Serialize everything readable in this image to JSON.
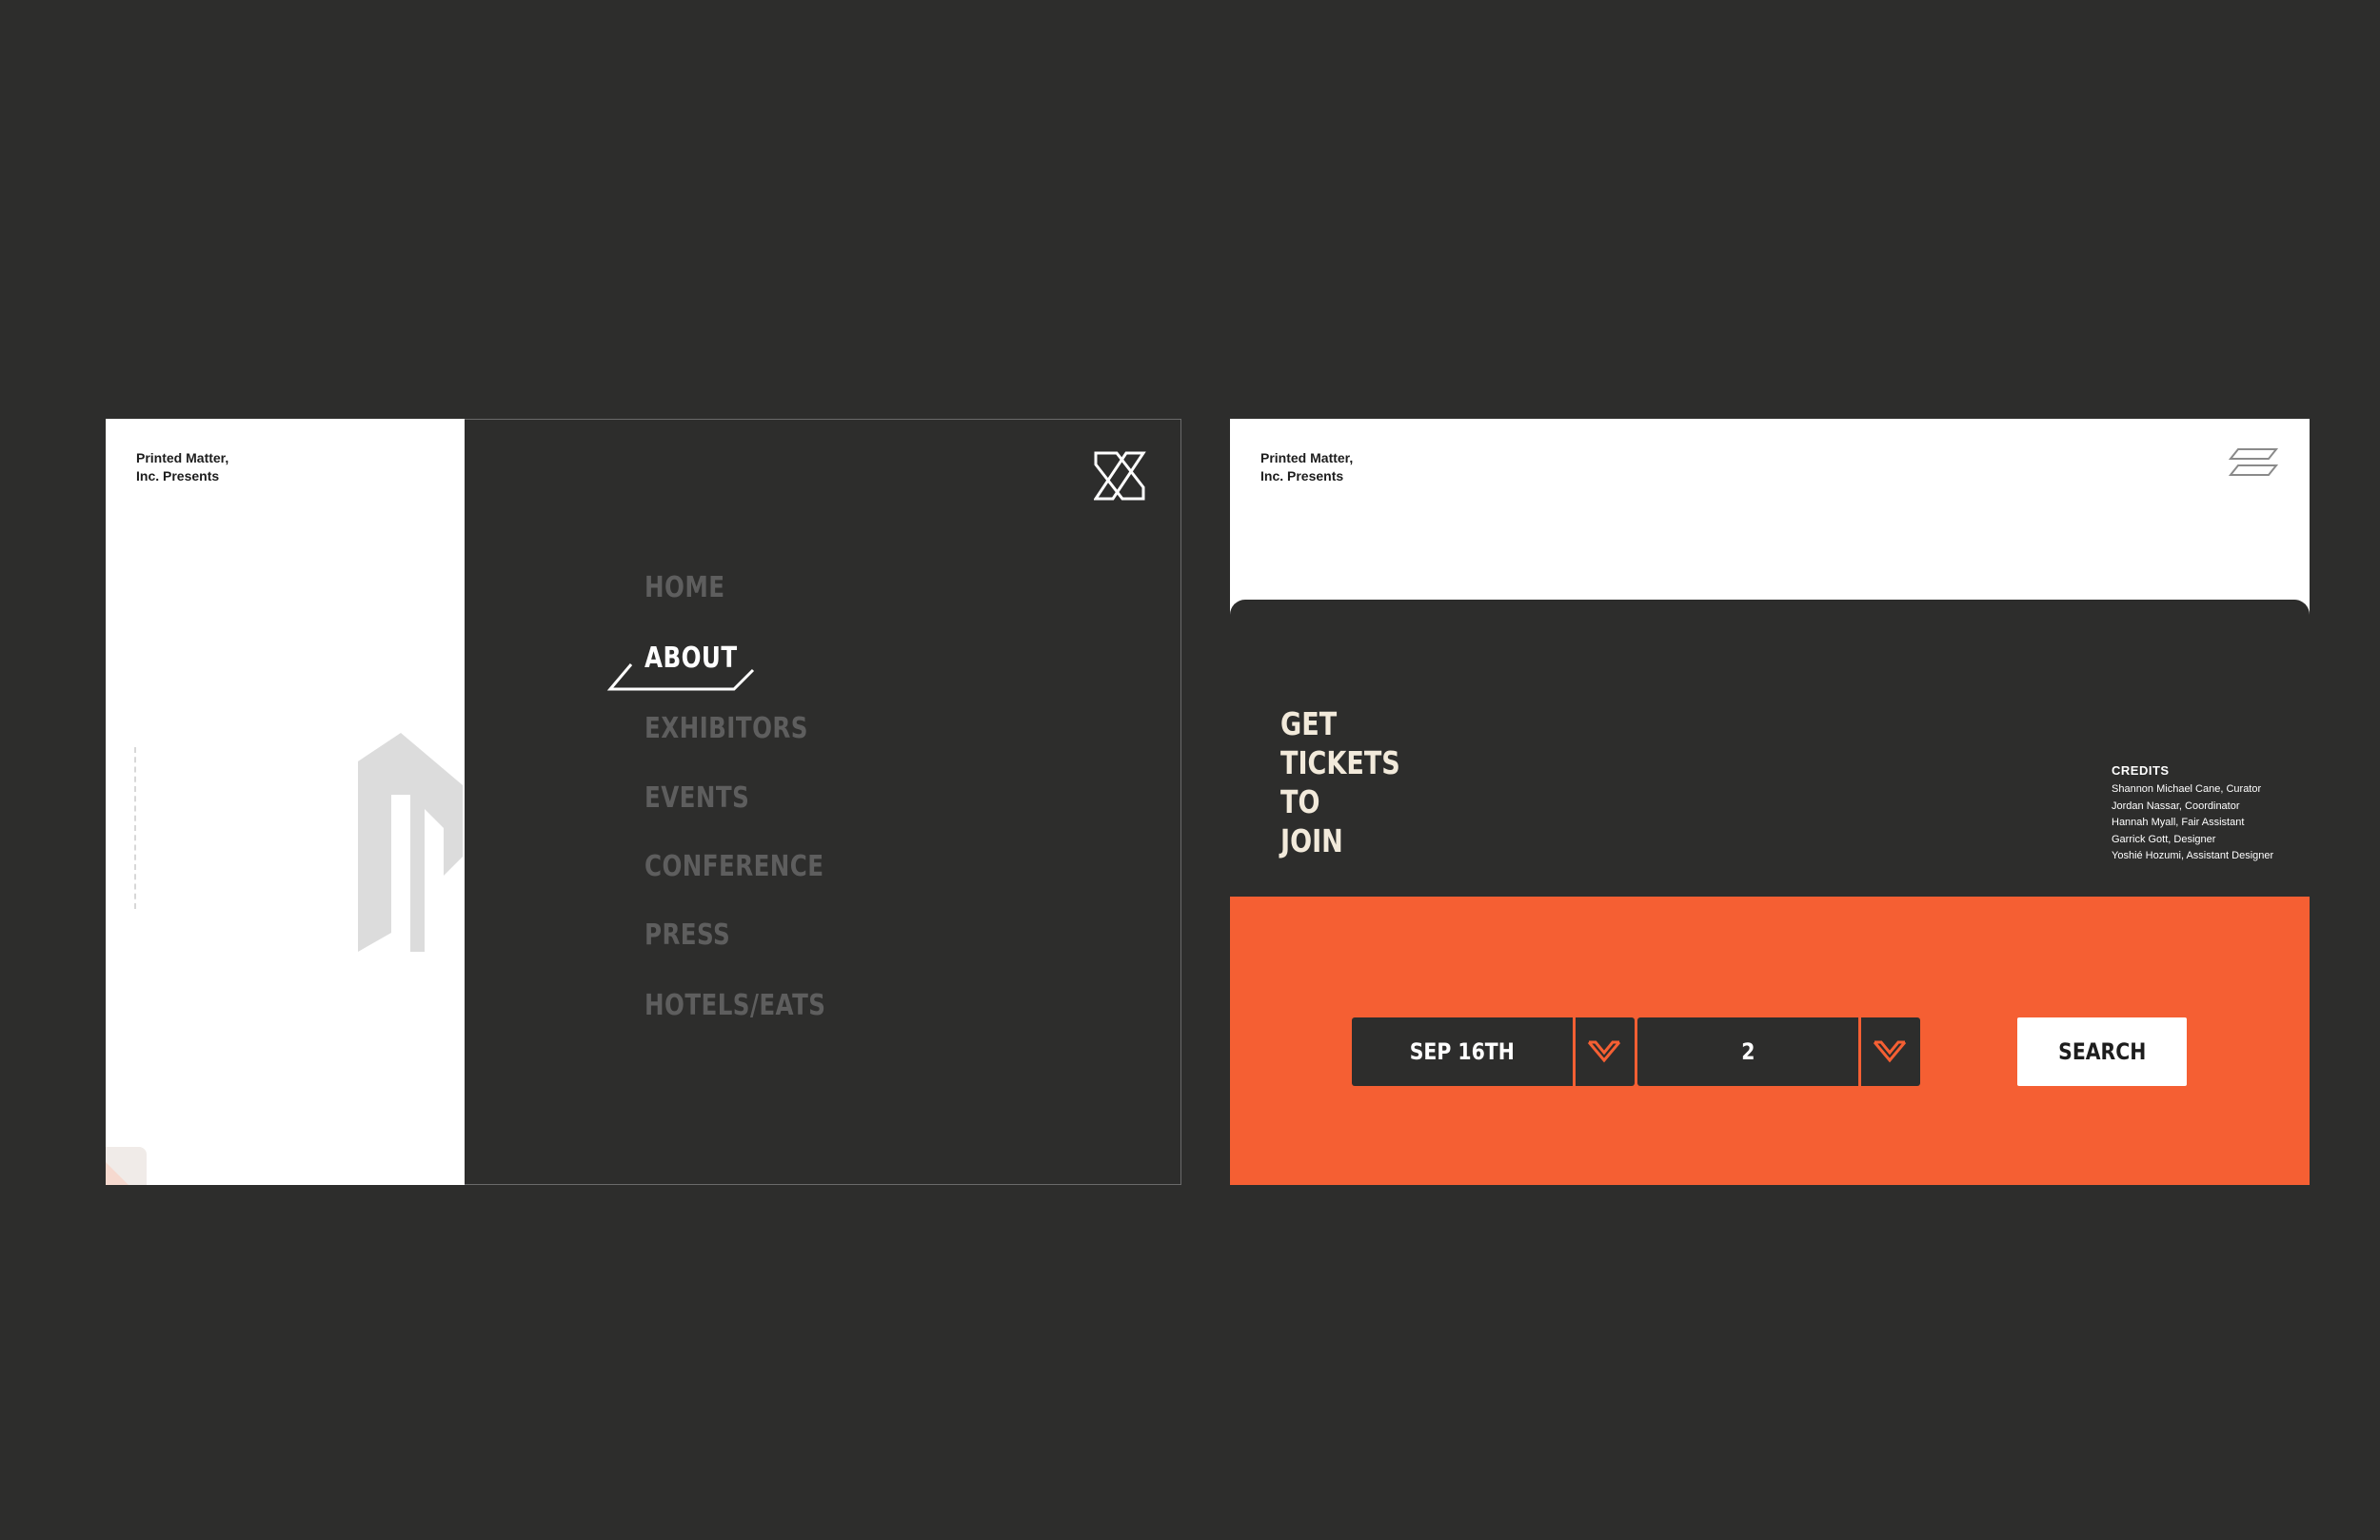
{
  "colors": {
    "background": "#2d2d2c",
    "accent": "#f55f33",
    "nav_inactive": "#5e5e5e",
    "cream": "#f2eadb"
  },
  "left_screen": {
    "brand_line1": "Printed Matter,",
    "brand_line2": "Inc. Presents",
    "close_icon": "close-x-icon",
    "nav_items": [
      {
        "label": "HOME",
        "active": false
      },
      {
        "label": "ABOUT",
        "active": true
      },
      {
        "label": "EXHIBITORS",
        "active": false
      },
      {
        "label": "EVENTS",
        "active": false
      },
      {
        "label": "CONFERENCE",
        "active": false
      },
      {
        "label": "PRESS",
        "active": false
      },
      {
        "label": "HOTELS/EATS",
        "active": false
      }
    ]
  },
  "right_screen": {
    "brand_line1": "Printed Matter,",
    "brand_line2": "Inc. Presents",
    "menu_icon": "hamburger-menu-icon",
    "tickets_title": [
      "GET",
      "TICKETS",
      "TO",
      "JOIN"
    ],
    "credits": {
      "heading": "CREDITS",
      "lines": [
        "Shannon Michael Cane, Curator",
        "Jordan Nassar, Coordinator",
        "Hannah Myall, Fair Assistant",
        "Garrick Gott, Designer",
        "Yoshié Hozumi, Assistant Designer"
      ]
    },
    "date_select": {
      "value": "SEP 16TH",
      "icon": "chevron-down-icon"
    },
    "quantity_select": {
      "value": "2",
      "icon": "chevron-down-icon"
    },
    "search_label": "SEARCH"
  }
}
